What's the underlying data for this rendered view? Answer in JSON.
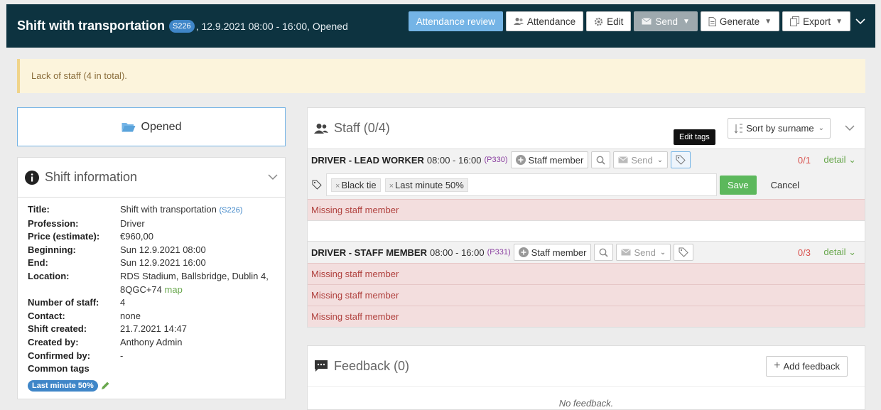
{
  "header": {
    "title": "Shift with transportation",
    "badge": "S226",
    "subtitle": ", 12.9.2021 08:00 - 16:00, Opened",
    "buttons": {
      "attendance_review": "Attendance review",
      "attendance": "Attendance",
      "edit": "Edit",
      "send": "Send",
      "generate": "Generate",
      "export": "Export"
    }
  },
  "alert": {
    "text": "Lack of staff (4 in total)."
  },
  "status": {
    "label": "Opened"
  },
  "shift_info": {
    "title": "Shift information",
    "rows": [
      {
        "key": "Title:",
        "value": "Shift with transportation",
        "extra": "(S226)"
      },
      {
        "key": "Profession:",
        "value": "Driver"
      },
      {
        "key": "Price (estimate):",
        "value": "€960,00"
      },
      {
        "key": "Beginning:",
        "value": "Sun 12.9.2021 08:00"
      },
      {
        "key": "End:",
        "value": "Sun 12.9.2021 16:00"
      },
      {
        "key": "Location:",
        "value": "RDS Stadium, Ballsbridge, Dublin 4,",
        "value2": "8QGC+74",
        "link": "map"
      },
      {
        "key": "Number of staff:",
        "value": "4"
      },
      {
        "key": "Contact:",
        "value": "none"
      },
      {
        "key": "Shift created:",
        "value": "21.7.2021 14:47"
      },
      {
        "key": "Created by:",
        "value": "Anthony Admin"
      },
      {
        "key": "Confirmed by:",
        "value": "-"
      },
      {
        "key": "Common tags",
        "value": ""
      }
    ],
    "common_tag": "Last minute 50%"
  },
  "staff": {
    "title": "Staff (0/4)",
    "sort_label": "Sort by surname",
    "tooltip": "Edit tags",
    "add_staff_label": "Staff member",
    "send_label": "Send",
    "detail_label": "detail",
    "missing_label": "Missing staff member",
    "groups": [
      {
        "name": "DRIVER - LEAD WORKER",
        "time": "08:00 - 16:00",
        "code": "(P330)",
        "count": "0/1"
      },
      {
        "name": "DRIVER - STAFF MEMBER",
        "time": "08:00 - 16:00",
        "code": "(P331)",
        "count": "0/3"
      }
    ],
    "tags": [
      "Black tie",
      "Last minute 50%"
    ],
    "save_label": "Save",
    "cancel_label": "Cancel"
  },
  "feedback": {
    "title": "Feedback (0)",
    "add_label": "Add feedback",
    "empty": "No feedback."
  },
  "colors": {
    "topbar": "#0d3340",
    "accent": "#3f86c8",
    "success": "#5cb85c",
    "danger": "#d9534f",
    "warning_bg": "#fcf4dc"
  }
}
